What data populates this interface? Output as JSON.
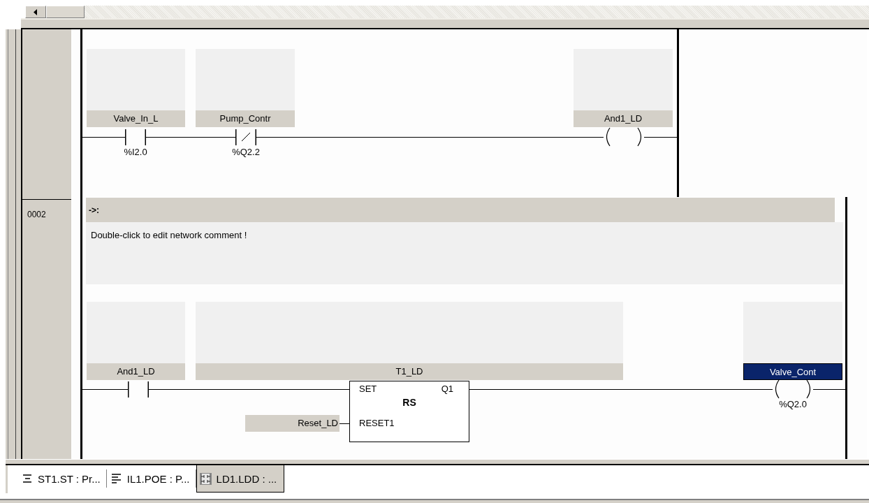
{
  "networks": [
    {
      "elements": [
        {
          "kind": "contact",
          "variable": "Valve_In_L",
          "address": "%I2.0",
          "selected": false
        },
        {
          "kind": "negated_contact",
          "variable": "Pump_Contr",
          "address": "%Q2.2",
          "selected": false
        },
        {
          "kind": "coil",
          "variable": "And1_LD",
          "selected": false
        }
      ]
    },
    {
      "number": "0002",
      "comment_title": "->:",
      "comment": "Double-click to edit network comment !",
      "elements": [
        {
          "kind": "contact",
          "variable": "And1_LD",
          "selected": false
        },
        {
          "kind": "block",
          "instance": "T1_LD",
          "type": "RS",
          "inputs": [
            {
              "pin": "SET"
            },
            {
              "pin": "RESET1",
              "variable": "Reset_LD"
            }
          ],
          "outputs": [
            {
              "pin": "Q1"
            }
          ],
          "selected": false
        },
        {
          "kind": "coil",
          "variable": "Valve_Cont",
          "address": "%Q2.0",
          "selected": true
        }
      ]
    }
  ],
  "tabs": [
    {
      "kind": "st",
      "label": "ST1.ST : Pr...",
      "selected": false
    },
    {
      "kind": "il",
      "label": "IL1.POE : P...",
      "selected": false
    },
    {
      "kind": "ld",
      "label": "LD1.LDD : ...",
      "selected": true
    }
  ]
}
